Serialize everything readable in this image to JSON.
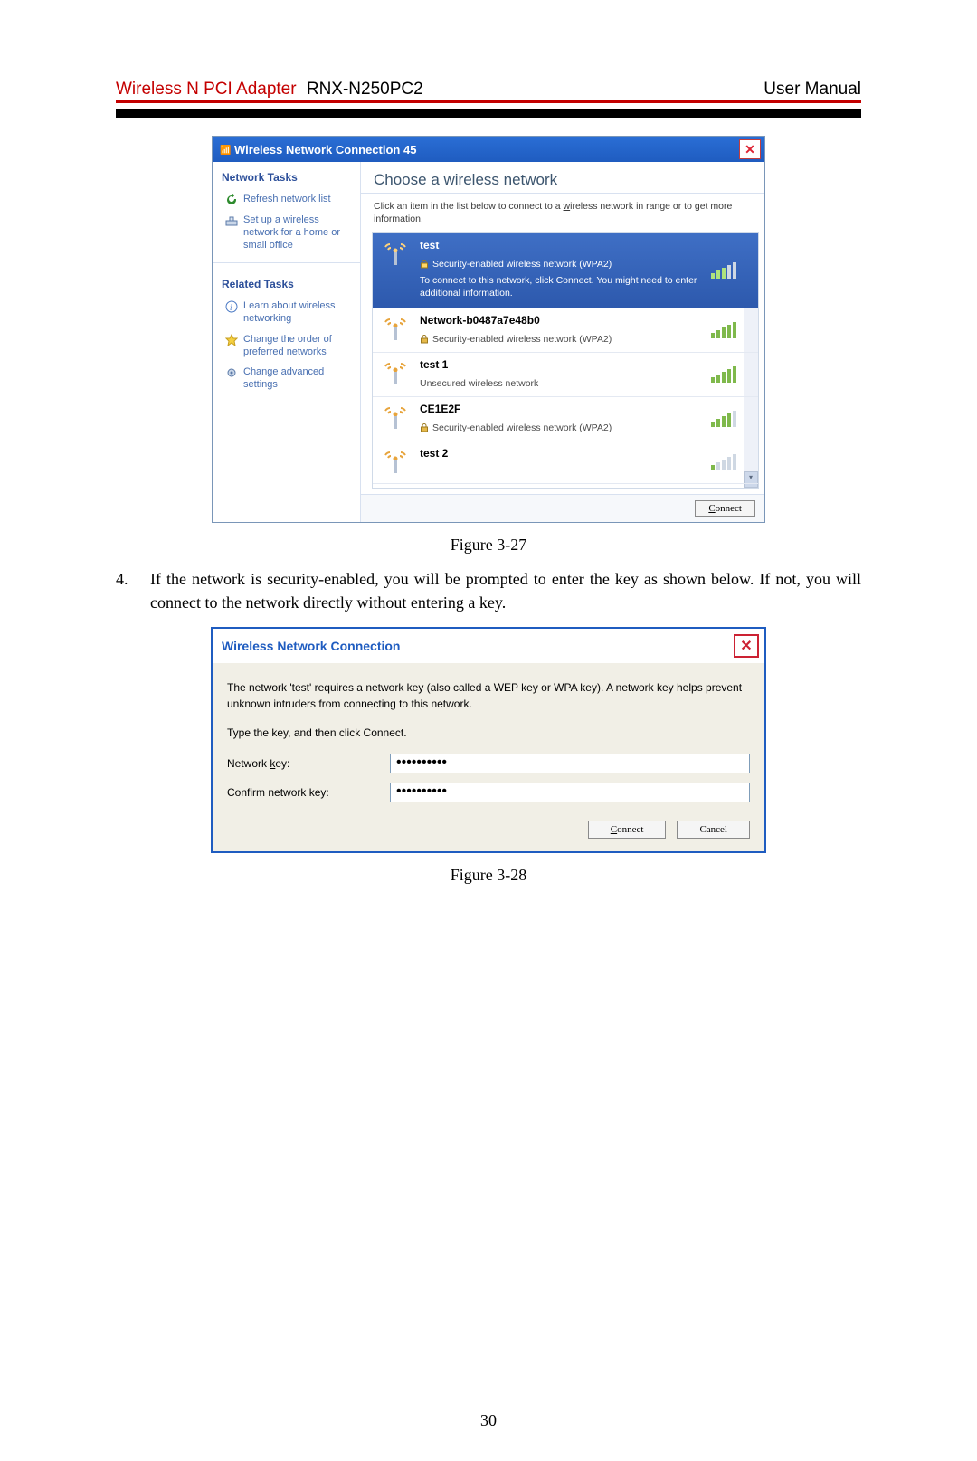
{
  "header": {
    "red": "Wireless N PCI Adapter",
    "black": "RNX-N250PC2",
    "right": "User Manual"
  },
  "fig27": {
    "title": "Wireless Network Connection 45",
    "sidebar": {
      "h1": "Network Tasks",
      "items1": [
        {
          "id": "refresh",
          "label": "Refresh network list"
        },
        {
          "id": "setup",
          "label": "Set up a wireless network for a home or small office"
        }
      ],
      "h2": "Related Tasks",
      "items2": [
        {
          "id": "learn",
          "label": "Learn about wireless networking"
        },
        {
          "id": "order",
          "label": "Change the order of preferred networks"
        },
        {
          "id": "adv",
          "label": "Change advanced settings"
        }
      ]
    },
    "main": {
      "h": "Choose a wireless network",
      "sub_pre": "Click an item in the list below to connect to a ",
      "sub_u": "w",
      "sub_post": "ireless network in range or to get more information.",
      "networks": [
        {
          "name": "test",
          "sec": "Security-enabled wireless network (WPA2)",
          "help": "To connect to this network, click Connect. You might need to enter additional information.",
          "lock": true,
          "sel": true,
          "bars": 3
        },
        {
          "name": "Network-b0487a7e48b0",
          "sec": "Security-enabled wireless network (WPA2)",
          "lock": true,
          "sel": false,
          "bars": 5
        },
        {
          "name": "test 1",
          "sec": "Unsecured wireless network",
          "lock": false,
          "sel": false,
          "bars": 5
        },
        {
          "name": "CE1E2F",
          "sec": "Security-enabled wireless network (WPA2)",
          "lock": true,
          "sel": false,
          "bars": 4
        },
        {
          "name": "test 2",
          "sec": "",
          "lock": false,
          "sel": false,
          "bars": 1
        }
      ],
      "connect_pre": "C",
      "connect_post": "onnect"
    },
    "caption": "Figure 3-27"
  },
  "para": {
    "num": "4.",
    "text": "If the network is security-enabled, you will be prompted to enter the key as shown below. If not, you will connect to the network directly without entering a key."
  },
  "fig28": {
    "title": "Wireless Network Connection",
    "p1": "The network 'test' requires a network key (also called a WEP key or WPA key). A network key helps prevent unknown intruders from connecting to this network.",
    "p2": "Type the key, and then click Connect.",
    "row1_pre": "Network ",
    "row1_u": "k",
    "row1_post": "ey:",
    "row2_pre": "Confirm network key:",
    "val": "••••••••••",
    "btn1_u": "C",
    "btn1_post": "onnect",
    "btn2": "Cancel",
    "caption": "Figure 3-28"
  },
  "pagenum": "30"
}
